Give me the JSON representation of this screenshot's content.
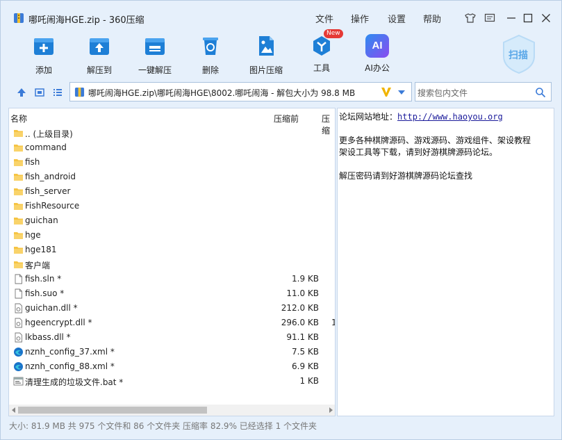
{
  "window": {
    "title": "哪吒闹海HGE.zip - 360压缩",
    "menu": [
      "文件",
      "操作",
      "设置",
      "帮助"
    ]
  },
  "toolbar": {
    "items": [
      {
        "label": "添加",
        "icon": "add-icon"
      },
      {
        "label": "解压到",
        "icon": "extract-to-icon"
      },
      {
        "label": "一键解压",
        "icon": "one-click-extract-icon"
      },
      {
        "label": "删除",
        "icon": "delete-icon"
      },
      {
        "label": "图片压缩",
        "icon": "image-compress-icon"
      },
      {
        "label": "工具",
        "icon": "tools-icon",
        "badge": "New"
      },
      {
        "label": "AI办公",
        "icon": "ai-office-icon",
        "icon_text": "AI"
      }
    ],
    "scan_label": "扫描"
  },
  "address": {
    "path": "哪吒闹海HGE.zip\\哪吒闹海HGE\\8002.哪吒闹海 - 解包大小为 98.8 MB"
  },
  "search": {
    "placeholder": "搜索包内文件"
  },
  "file_list": {
    "columns": [
      "名称",
      "压缩前",
      "压缩"
    ],
    "rows": [
      {
        "name": ".. (上级目录)",
        "size": "",
        "type": "folder"
      },
      {
        "name": "command",
        "size": "",
        "type": "folder"
      },
      {
        "name": "fish",
        "size": "",
        "type": "folder"
      },
      {
        "name": "fish_android",
        "size": "",
        "type": "folder"
      },
      {
        "name": "fish_server",
        "size": "",
        "type": "folder"
      },
      {
        "name": "FishResource",
        "size": "",
        "type": "folder"
      },
      {
        "name": "guichan",
        "size": "",
        "type": "folder"
      },
      {
        "name": "hge",
        "size": "",
        "type": "folder"
      },
      {
        "name": "hge181",
        "size": "",
        "type": "folder"
      },
      {
        "name": "客户端",
        "size": "",
        "type": "folder"
      },
      {
        "name": "fish.sln *",
        "size": "1.9 KB",
        "type": "file"
      },
      {
        "name": "fish.suo *",
        "size": "11.0 KB",
        "type": "file"
      },
      {
        "name": "guichan.dll *",
        "size": "212.0 KB",
        "type": "dll"
      },
      {
        "name": "hgeencrypt.dll *",
        "size": "296.0 KB",
        "type": "dll",
        "extra": "1"
      },
      {
        "name": "lkbass.dll *",
        "size": "91.1 KB",
        "type": "dll"
      },
      {
        "name": "nznh_config_37.xml *",
        "size": "7.5 KB",
        "type": "xml"
      },
      {
        "name": "nznh_config_88.xml *",
        "size": "6.9 KB",
        "type": "xml"
      },
      {
        "name": "清理生成的垃圾文件.bat *",
        "size": "1 KB",
        "type": "bat"
      }
    ]
  },
  "comment": {
    "line1_label": "论坛网站地址：",
    "line1_link": "http://www.haoyou.org",
    "line2": "更多各种棋牌源码、游戏源码、游戏组件、架设教程",
    "line3": "架设工具等下载，请到好游棋牌源码论坛。",
    "line4": "解压密码请到好游棋牌源码论坛查找"
  },
  "status": "大小: 81.9 MB 共 975 个文件和 86 个文件夹 压缩率 82.9% 已经选择 1 个文件夹",
  "colors": {
    "accent": "#1e7fd6",
    "window_bg": "#e6f0fb",
    "folder": "#f6c443"
  }
}
